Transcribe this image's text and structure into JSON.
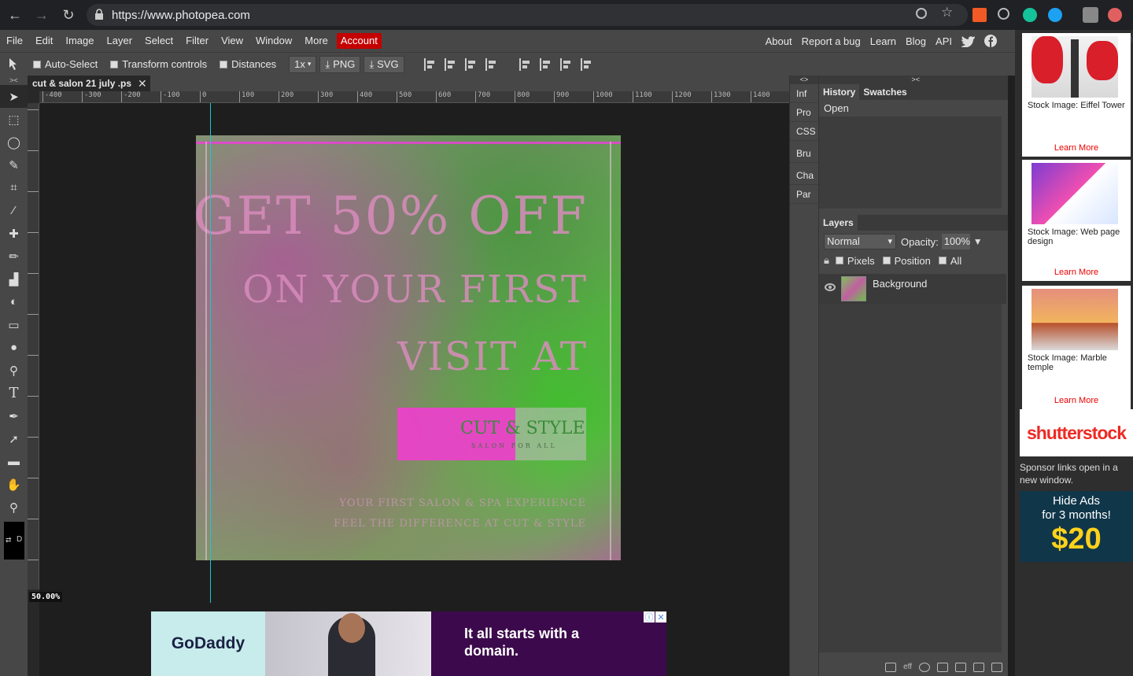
{
  "browser": {
    "url": "https://www.photopea.com"
  },
  "menu": {
    "items": [
      "File",
      "Edit",
      "Image",
      "Layer",
      "Select",
      "Filter",
      "View",
      "Window",
      "More"
    ],
    "account": "Account",
    "right_items": [
      "About",
      "Report a bug",
      "Learn",
      "Blog",
      "API"
    ]
  },
  "options": {
    "auto_select": "Auto-Select",
    "transform_controls": "Transform controls",
    "distances": "Distances",
    "scale": "1x",
    "png": "PNG",
    "svg": "SVG"
  },
  "document": {
    "tab_title": "cut & salon 21 july .ps",
    "zoom": "50.00%",
    "ruler_labels": [
      "-400",
      "-300",
      "-200",
      "-100",
      "0",
      "100",
      "200",
      "300",
      "400",
      "500",
      "600",
      "700",
      "800",
      "900",
      "1000",
      "1100",
      "1200",
      "1300",
      "1400"
    ],
    "artwork": {
      "line1": "GET 50% OFF",
      "line2": "ON YOUR FIRST",
      "line3": "VISIT AT",
      "logo_main": "CUT & STYLE",
      "logo_sub": "SALON FOR ALL",
      "small1": "YOUR FIRST SALON & SPA EXPERIENCE",
      "small2": "FEEL THE DIFFERENCE AT CUT & STYLE"
    }
  },
  "mini_panel": {
    "items": [
      "Inf",
      "Pro",
      "CSS",
      "Bru",
      "Cha",
      "Par"
    ]
  },
  "history": {
    "tab_history": "History",
    "tab_swatches": "Swatches",
    "entry": "Open"
  },
  "layers": {
    "title": "Layers",
    "blend_mode": "Normal",
    "opacity_label": "Opacity:",
    "opacity_value": "100%",
    "lock_pixels": "Pixels",
    "lock_position": "Position",
    "lock_all": "All",
    "layer_name": "Background"
  },
  "ads": {
    "stock": [
      {
        "caption": "Stock Image: Eiffel Tower",
        "learn": "Learn More"
      },
      {
        "caption": "Stock Image: Web page design",
        "learn": "Learn More"
      },
      {
        "caption": "Stock Image: Marble temple",
        "learn": "Learn More"
      }
    ],
    "shutterstock": "shutterstock",
    "sponsor_note": "Sponsor links open in a new window.",
    "hide_ads_line1": "Hide Ads",
    "hide_ads_line2": "for 3 months!",
    "hide_ads_price": "$20",
    "bottom_brand": "GoDaddy",
    "bottom_message": "It all starts with a domain."
  },
  "colors": {
    "account_red": "#c40000",
    "guide_cyan": "#1ec6d3",
    "panel_gray": "#474747"
  }
}
